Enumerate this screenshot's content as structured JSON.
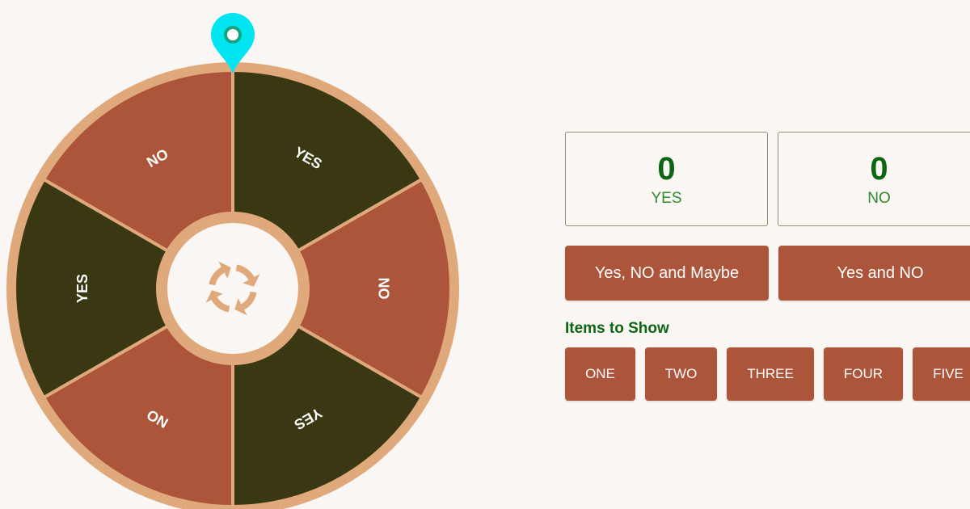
{
  "wheel": {
    "segments": [
      {
        "label": "YES",
        "color": "#3a3813"
      },
      {
        "label": "NO",
        "color": "#ad553b"
      },
      {
        "label": "YES",
        "color": "#3a3813"
      },
      {
        "label": "NO",
        "color": "#ad553b"
      },
      {
        "label": "YES",
        "color": "#3a3813"
      },
      {
        "label": "NO",
        "color": "#ad553b"
      }
    ],
    "rim_color": "#dfa97c",
    "hub_color": "#faf6f3",
    "pointer_color": "#00e5f0",
    "spin_icon": "refresh-icon"
  },
  "counters": [
    {
      "value": "0",
      "label": "YES"
    },
    {
      "value": "0",
      "label": "NO"
    }
  ],
  "modes": [
    {
      "label": "Yes, NO and Maybe"
    },
    {
      "label": "Yes and NO"
    }
  ],
  "items_title": "Items to Show",
  "items": [
    {
      "label": "ONE"
    },
    {
      "label": "TWO"
    },
    {
      "label": "THREE"
    },
    {
      "label": "FOUR"
    },
    {
      "label": "FIVE"
    }
  ]
}
